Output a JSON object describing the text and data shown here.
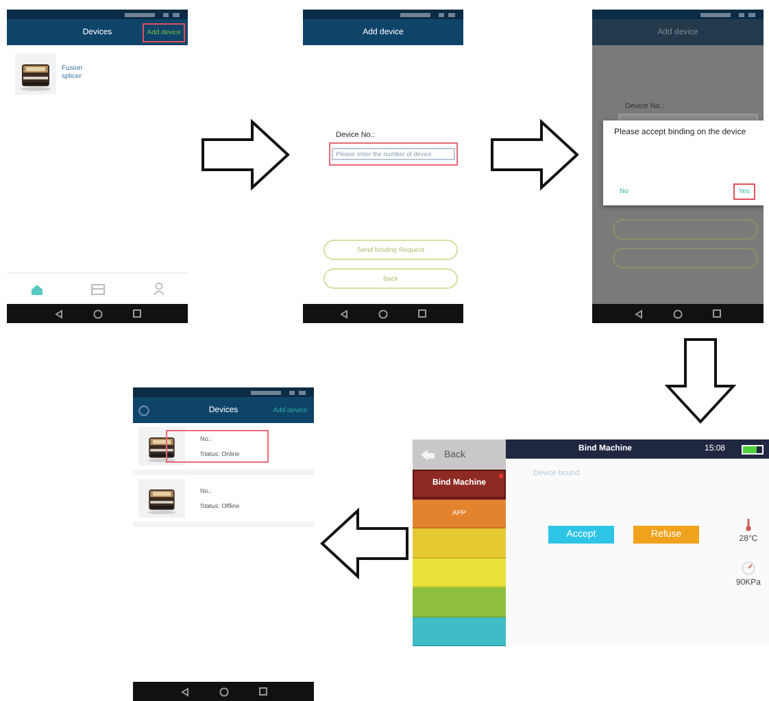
{
  "devices_screen": {
    "title": "Devices",
    "action": "Add device",
    "action_highlighted": true,
    "devices": [
      {
        "label": "Fusion splicer"
      }
    ],
    "nav": [
      {
        "kind": "home",
        "selected": true
      },
      {
        "kind": "package",
        "selected": false
      },
      {
        "kind": "person",
        "selected": false
      }
    ]
  },
  "add_device_screen": {
    "title": "Add device",
    "field_label": "Device No.:",
    "placeholder": "Please enter the number of device",
    "field_highlighted": true,
    "buttons": [
      "Send binding Request",
      "Back"
    ]
  },
  "confirm_screen": {
    "title": "Add device",
    "field_label": "Device No.:",
    "dialog": {
      "message": "Please accept binding on the device",
      "no": "No",
      "yes": "Yes",
      "yes_highlighted": true
    }
  },
  "machine_screen": {
    "back": "Back",
    "title": "Bind Machine",
    "time": "15:08",
    "battery": {
      "level": 0.7
    },
    "menu": [
      {
        "label": "Bind Machine",
        "selected": true,
        "color": "#8e2a24"
      },
      {
        "label": "APP",
        "selected": false,
        "color": "#e4832e"
      },
      {
        "selected": false,
        "color": "#e6c930"
      },
      {
        "selected": false,
        "color": "#e8e23a"
      },
      {
        "selected": false,
        "color": "#8fbf3f"
      },
      {
        "selected": false,
        "color": "#3fbcc6"
      }
    ],
    "status": "Device bound",
    "accept": "Accept",
    "refuse": "Refuse",
    "temperature": "28°C",
    "pressure": "90KPa"
  },
  "result_screen": {
    "title": "Devices",
    "action": "Add device",
    "devices": [
      {
        "number": "No.:",
        "status": "Status: Online",
        "highlighted": true
      },
      {
        "number": "No.:",
        "status": "Status: Offline",
        "highlighted": false
      }
    ]
  }
}
